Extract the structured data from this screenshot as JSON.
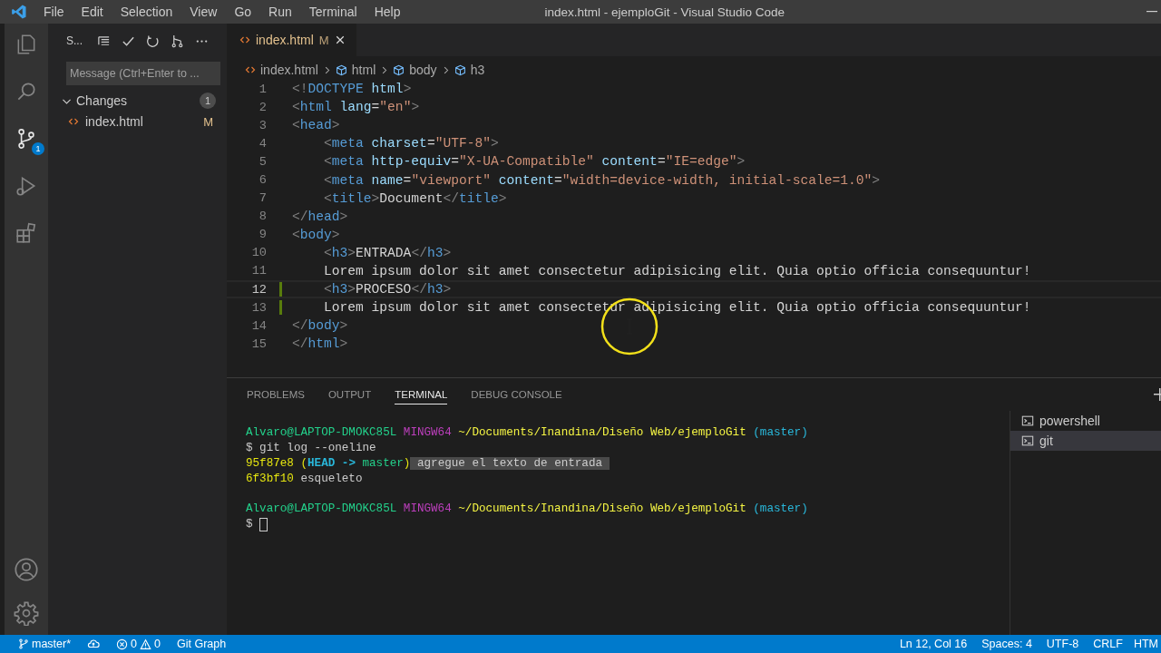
{
  "window": {
    "title": "index.html - ejemploGit - Visual Studio Code"
  },
  "menu": [
    "File",
    "Edit",
    "Selection",
    "View",
    "Go",
    "Run",
    "Terminal",
    "Help"
  ],
  "activity_bar": [
    {
      "kind": "files",
      "selected": false
    },
    {
      "kind": "search",
      "selected": false
    },
    {
      "kind": "source-control",
      "selected": true,
      "badge": "1"
    },
    {
      "kind": "run",
      "selected": false
    },
    {
      "kind": "extensions",
      "selected": false
    }
  ],
  "sidebar": {
    "title": "S...",
    "message": {
      "placeholder": "Message (Ctrl+Enter to ..."
    },
    "changes": {
      "label": "Changes",
      "count": "1",
      "expanded": true,
      "files": [
        {
          "name": "index.html",
          "status": "M"
        }
      ]
    }
  },
  "tabs": [
    {
      "label": "index.html",
      "status": "M",
      "selected": true
    }
  ],
  "breadcrumb": [
    {
      "kind": "file",
      "label": "index.html"
    },
    {
      "kind": "element",
      "label": "html"
    },
    {
      "kind": "element",
      "label": "body"
    },
    {
      "kind": "element",
      "label": "h3"
    }
  ],
  "code": [
    {
      "number": "1",
      "current": false,
      "changed": false,
      "indented": false,
      "tokens": [
        {
          "kind": "punct",
          "text": "<!"
        },
        {
          "kind": "tag",
          "text": "DOCTYPE"
        },
        {
          "kind": "attr",
          "text": " html"
        },
        {
          "kind": "punct",
          "text": ">"
        }
      ]
    },
    {
      "number": "2",
      "current": false,
      "changed": false,
      "indented": false,
      "tokens": [
        {
          "kind": "punct",
          "text": "<"
        },
        {
          "kind": "tag",
          "text": "html"
        },
        {
          "kind": "attr",
          "text": " lang"
        },
        {
          "kind": "text",
          "text": "="
        },
        {
          "kind": "str",
          "text": "\"en\""
        },
        {
          "kind": "punct",
          "text": ">"
        }
      ]
    },
    {
      "number": "3",
      "current": false,
      "changed": false,
      "indented": false,
      "tokens": [
        {
          "kind": "punct",
          "text": "<"
        },
        {
          "kind": "tag",
          "text": "head"
        },
        {
          "kind": "punct",
          "text": ">"
        }
      ]
    },
    {
      "number": "4",
      "current": false,
      "changed": false,
      "indented": true,
      "tokens": [
        {
          "kind": "punct",
          "text": "<"
        },
        {
          "kind": "tag",
          "text": "meta"
        },
        {
          "kind": "attr",
          "text": " charset"
        },
        {
          "kind": "text",
          "text": "="
        },
        {
          "kind": "str",
          "text": "\"UTF-8\""
        },
        {
          "kind": "punct",
          "text": ">"
        }
      ]
    },
    {
      "number": "5",
      "current": false,
      "changed": false,
      "indented": true,
      "tokens": [
        {
          "kind": "punct",
          "text": "<"
        },
        {
          "kind": "tag",
          "text": "meta"
        },
        {
          "kind": "attr",
          "text": " http-equiv"
        },
        {
          "kind": "text",
          "text": "="
        },
        {
          "kind": "str",
          "text": "\"X-UA-Compatible\""
        },
        {
          "kind": "attr",
          "text": " content"
        },
        {
          "kind": "text",
          "text": "="
        },
        {
          "kind": "str",
          "text": "\"IE=edge\""
        },
        {
          "kind": "punct",
          "text": ">"
        }
      ]
    },
    {
      "number": "6",
      "current": false,
      "changed": false,
      "indented": true,
      "tokens": [
        {
          "kind": "punct",
          "text": "<"
        },
        {
          "kind": "tag",
          "text": "meta"
        },
        {
          "kind": "attr",
          "text": " name"
        },
        {
          "kind": "text",
          "text": "="
        },
        {
          "kind": "str",
          "text": "\"viewport\""
        },
        {
          "kind": "attr",
          "text": " content"
        },
        {
          "kind": "text",
          "text": "="
        },
        {
          "kind": "str",
          "text": "\"width=device-width, initial-scale=1.0\""
        },
        {
          "kind": "punct",
          "text": ">"
        }
      ]
    },
    {
      "number": "7",
      "current": false,
      "changed": false,
      "indented": true,
      "tokens": [
        {
          "kind": "punct",
          "text": "<"
        },
        {
          "kind": "tag",
          "text": "title"
        },
        {
          "kind": "punct",
          "text": ">"
        },
        {
          "kind": "text",
          "text": "Document"
        },
        {
          "kind": "punct",
          "text": "</"
        },
        {
          "kind": "tag",
          "text": "title"
        },
        {
          "kind": "punct",
          "text": ">"
        }
      ]
    },
    {
      "number": "8",
      "current": false,
      "changed": false,
      "indented": false,
      "tokens": [
        {
          "kind": "punct",
          "text": "</"
        },
        {
          "kind": "tag",
          "text": "head"
        },
        {
          "kind": "punct",
          "text": ">"
        }
      ]
    },
    {
      "number": "9",
      "current": false,
      "changed": false,
      "indented": false,
      "tokens": [
        {
          "kind": "punct",
          "text": "<"
        },
        {
          "kind": "tag",
          "text": "body"
        },
        {
          "kind": "punct",
          "text": ">"
        }
      ]
    },
    {
      "number": "10",
      "current": false,
      "changed": false,
      "indented": true,
      "tokens": [
        {
          "kind": "punct",
          "text": "<"
        },
        {
          "kind": "tag",
          "text": "h3"
        },
        {
          "kind": "punct",
          "text": ">"
        },
        {
          "kind": "text",
          "text": "ENTRADA"
        },
        {
          "kind": "punct",
          "text": "</"
        },
        {
          "kind": "tag",
          "text": "h3"
        },
        {
          "kind": "punct",
          "text": ">"
        }
      ]
    },
    {
      "number": "11",
      "current": false,
      "changed": false,
      "indented": true,
      "tokens": [
        {
          "kind": "text",
          "text": "Lorem ipsum dolor sit amet consectetur adipisicing elit. Quia optio officia consequuntur!"
        }
      ]
    },
    {
      "number": "12",
      "current": true,
      "changed": true,
      "indented": true,
      "tokens": [
        {
          "kind": "punct",
          "text": "<"
        },
        {
          "kind": "tag",
          "text": "h3"
        },
        {
          "kind": "punct",
          "text": ">"
        },
        {
          "kind": "text",
          "text": "PROCESO"
        },
        {
          "kind": "punct",
          "text": "</"
        },
        {
          "kind": "tag",
          "text": "h3"
        },
        {
          "kind": "punct",
          "text": ">"
        }
      ]
    },
    {
      "number": "13",
      "current": false,
      "changed": true,
      "indented": true,
      "tokens": [
        {
          "kind": "text",
          "text": "Lorem ipsum dolor sit amet consectetur adipisicing elit. Quia optio officia consequuntur!"
        }
      ]
    },
    {
      "number": "14",
      "current": false,
      "changed": false,
      "indented": false,
      "tokens": [
        {
          "kind": "punct",
          "text": "</"
        },
        {
          "kind": "tag",
          "text": "body"
        },
        {
          "kind": "punct",
          "text": ">"
        }
      ]
    },
    {
      "number": "15",
      "current": false,
      "changed": false,
      "indented": false,
      "tokens": [
        {
          "kind": "punct",
          "text": "</"
        },
        {
          "kind": "tag",
          "text": "html"
        },
        {
          "kind": "punct",
          "text": ">"
        }
      ]
    }
  ],
  "panel": {
    "tabs": [
      {
        "label": "PROBLEMS",
        "selected": false
      },
      {
        "label": "OUTPUT",
        "selected": false
      },
      {
        "label": "TERMINAL",
        "selected": true
      },
      {
        "label": "DEBUG CONSOLE",
        "selected": false
      }
    ],
    "terminal": [
      {
        "gap_before": false,
        "cursor": false,
        "segments": [
          {
            "kind": "user",
            "text": "Alvaro@LAPTOP-DMOKC85L"
          },
          {
            "kind": "host",
            "text": " MINGW64"
          },
          {
            "kind": "path",
            "text": " ~/Documents/Inandina/Diseño Web/ejemploGit"
          },
          {
            "kind": "branch",
            "text": " (master)"
          }
        ]
      },
      {
        "gap_before": false,
        "cursor": false,
        "segments": [
          {
            "kind": "plain",
            "text": "$ git log --oneline"
          }
        ]
      },
      {
        "gap_before": false,
        "cursor": false,
        "segments": [
          {
            "kind": "hash",
            "text": "95f87e8 ("
          },
          {
            "kind": "head",
            "text": "HEAD -> "
          },
          {
            "kind": "user",
            "text": "master"
          },
          {
            "kind": "hash",
            "text": ")"
          },
          {
            "kind": "selected",
            "text": " agregue el texto de entrada "
          }
        ]
      },
      {
        "gap_before": false,
        "cursor": false,
        "segments": [
          {
            "kind": "hash",
            "text": "6f3bf10"
          },
          {
            "kind": "plain",
            "text": " esqueleto"
          }
        ]
      },
      {
        "gap_before": true,
        "cursor": false,
        "segments": [
          {
            "kind": "user",
            "text": "Alvaro@LAPTOP-DMOKC85L"
          },
          {
            "kind": "host",
            "text": " MINGW64"
          },
          {
            "kind": "path",
            "text": " ~/Documents/Inandina/Diseño Web/ejemploGit"
          },
          {
            "kind": "branch",
            "text": " (master)"
          }
        ]
      },
      {
        "gap_before": false,
        "cursor": true,
        "segments": [
          {
            "kind": "plain",
            "text": "$"
          }
        ]
      }
    ],
    "shells": [
      {
        "label": "powershell",
        "selected": false
      },
      {
        "label": "git",
        "selected": true
      }
    ]
  },
  "status_bar": {
    "branch": "master*",
    "errors": "0",
    "warnings": "0",
    "git_graph": "Git Graph",
    "right": [
      "Ln 12, Col 16",
      "Spaces: 4",
      "UTF-8",
      "CRLF",
      "HTM"
    ]
  }
}
